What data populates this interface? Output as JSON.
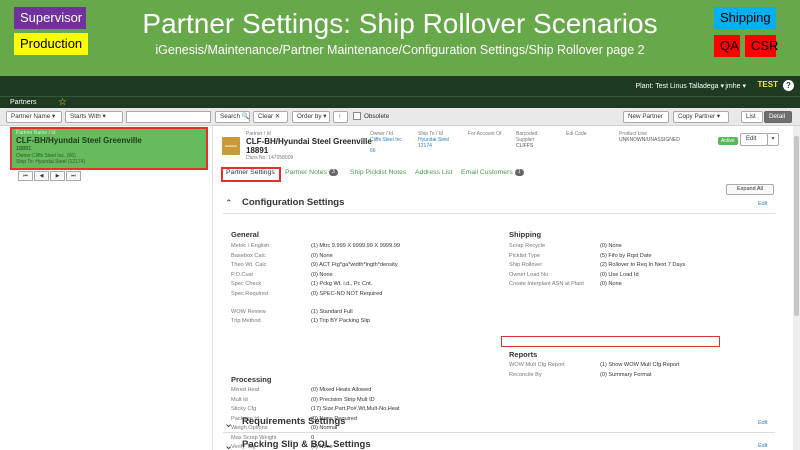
{
  "slide": {
    "title": "Partner Settings: Ship Rollover Scenarios",
    "path": "iGenesis/Maintenance/Partner Maintenance/Configuration Settings/Ship Rollover page 2",
    "tags": {
      "supervisor": "Supervisor",
      "production": "Production",
      "shipping": "Shipping",
      "qa": "QA",
      "csr": "CSR"
    },
    "colors": {
      "background": "#67a84a",
      "supervisor": "#7030a0",
      "production": "#ffff00",
      "shipping": "#00b0f0",
      "qa": "#ff0000",
      "csr": "#ff0000"
    }
  },
  "topbar": {
    "plant": "Plant: Test Linus Talladega ▾",
    "user": "jmhe ▾",
    "env": "TEST",
    "help": "?"
  },
  "subbar": {
    "label": "Partners",
    "star": "☆"
  },
  "toolbar": {
    "filter1": "Partner Name ▾",
    "filter2": "Starts With ▾",
    "search": "Search 🔍",
    "clear": "Clear ✕",
    "order": "Order by ▾",
    "sort": "↑",
    "obsolete": "Obsolete",
    "new_partner": "New Partner",
    "copy_partner": "Copy Partner ▾",
    "list": "List",
    "detail": "Detail"
  },
  "left_card": {
    "label": "Partner Name / Id",
    "name": "CLF-BH/Hyundai Steel Greenville",
    "id": "18891",
    "owner": "Owner:Cliffs Steel Inc. (66)",
    "ship_to": "Ship To: Hyundai Steel (12174)"
  },
  "pager": [
    "⏮",
    "◀",
    "▶",
    "⏭"
  ],
  "header": {
    "box": "—",
    "name_label": "Partner / Id",
    "name_line1": "CLF-BH/Hyundai Steel Greenville",
    "name_line2": "18891",
    "duns": "Duns No: 147058009",
    "owner_label": "Owner / Id",
    "owner_value": "Cliffs Steel Inc.",
    "owner_id": "66",
    "shipto_label": "Ship To / Id",
    "shipto_value": "Hyundai Steel",
    "shipto_id": "12174",
    "account_label": "For Account Of",
    "barcoded_label": "Barcoded Supplier",
    "barcoded_value": "CLIFFS",
    "edi_label": "Edi Code",
    "product_label": "Product Line",
    "product_value": "UNKNOWN/UNASSIGNED",
    "active": "Active",
    "edit": "Edit",
    "edit_caret": "▾"
  },
  "tabs": [
    {
      "label": "Partner Settings",
      "badge": ""
    },
    {
      "label": "Partner Notes",
      "badge": "3"
    },
    {
      "label": "Ship Picklist Notes",
      "badge": ""
    },
    {
      "label": "Address List",
      "badge": ""
    },
    {
      "label": "Email Customers",
      "badge": "1"
    }
  ],
  "expand_all": "Expand All",
  "edit_link": "Edit",
  "config": {
    "title": "Configuration Settings",
    "general": {
      "heading": "General",
      "rows": [
        {
          "label": "Metric / English",
          "value": "(1) Mtrc 9.999 X 9999.99 X 9999.99"
        },
        {
          "label": "Basebox Calc",
          "value": "(0) None"
        },
        {
          "label": "Theo Wt. Calc",
          "value": "(9) ACT Ftg*ga*width*lngth*density"
        },
        {
          "label": "P.O.Cust",
          "value": "(0) None"
        },
        {
          "label": "Spec Check",
          "value": "(1) Pckg Wt. i.d., Pc Cnt."
        },
        {
          "label": "Spec Required",
          "value": "(0) SPEC-NO NOT Required"
        },
        {
          "label": "WOW Review",
          "value": "(1) Standard Full"
        },
        {
          "label": "Trip Method",
          "value": "(1) Trip BY Packing Slip"
        }
      ]
    },
    "processing": {
      "heading": "Processing",
      "rows": [
        {
          "label": "Mixed Heat",
          "value": "(0) Mixed Heats Allowed"
        },
        {
          "label": "Mult Id",
          "value": "(0) Precision Strip Mult ID"
        },
        {
          "label": "Sticky Cfg",
          "value": "(17) Size,Part,Po#,Wt,Mult-No,Heat"
        },
        {
          "label": "Package Id",
          "value": "(0) None Required"
        },
        {
          "label": "Weigh Options",
          "value": "(0) Normal"
        },
        {
          "label": "Max Scrap Weight",
          "value": "0"
        },
        {
          "label": "Verify Tag",
          "value": "(0) None"
        }
      ]
    },
    "shipping": {
      "heading": "Shipping",
      "rows": [
        {
          "label": "Scrap Recycle",
          "value": "(0) None"
        },
        {
          "label": "Picklist Type",
          "value": "(5) Fifo by Rqst Date"
        },
        {
          "label": "Ship Rollover",
          "value": "(2) Rollover to Req In Next 7 Days"
        },
        {
          "label": "Owner Load No",
          "value": "(0) Use Load Id"
        },
        {
          "label": "Create Interplant ASN at Plant",
          "value": "(0) None"
        }
      ]
    },
    "reports": {
      "heading": "Reports",
      "rows": [
        {
          "label": "WOW Mult Cfg Report",
          "value": "(1) Show WOW Mult Cfg Report"
        },
        {
          "label": "Reconcile By",
          "value": "(0) Summary Format"
        }
      ]
    }
  },
  "sections": [
    {
      "title": "Requirements Settings",
      "edit": "Edit"
    },
    {
      "title": "Packing Slip & BOL Settings",
      "edit": "Edit"
    }
  ]
}
